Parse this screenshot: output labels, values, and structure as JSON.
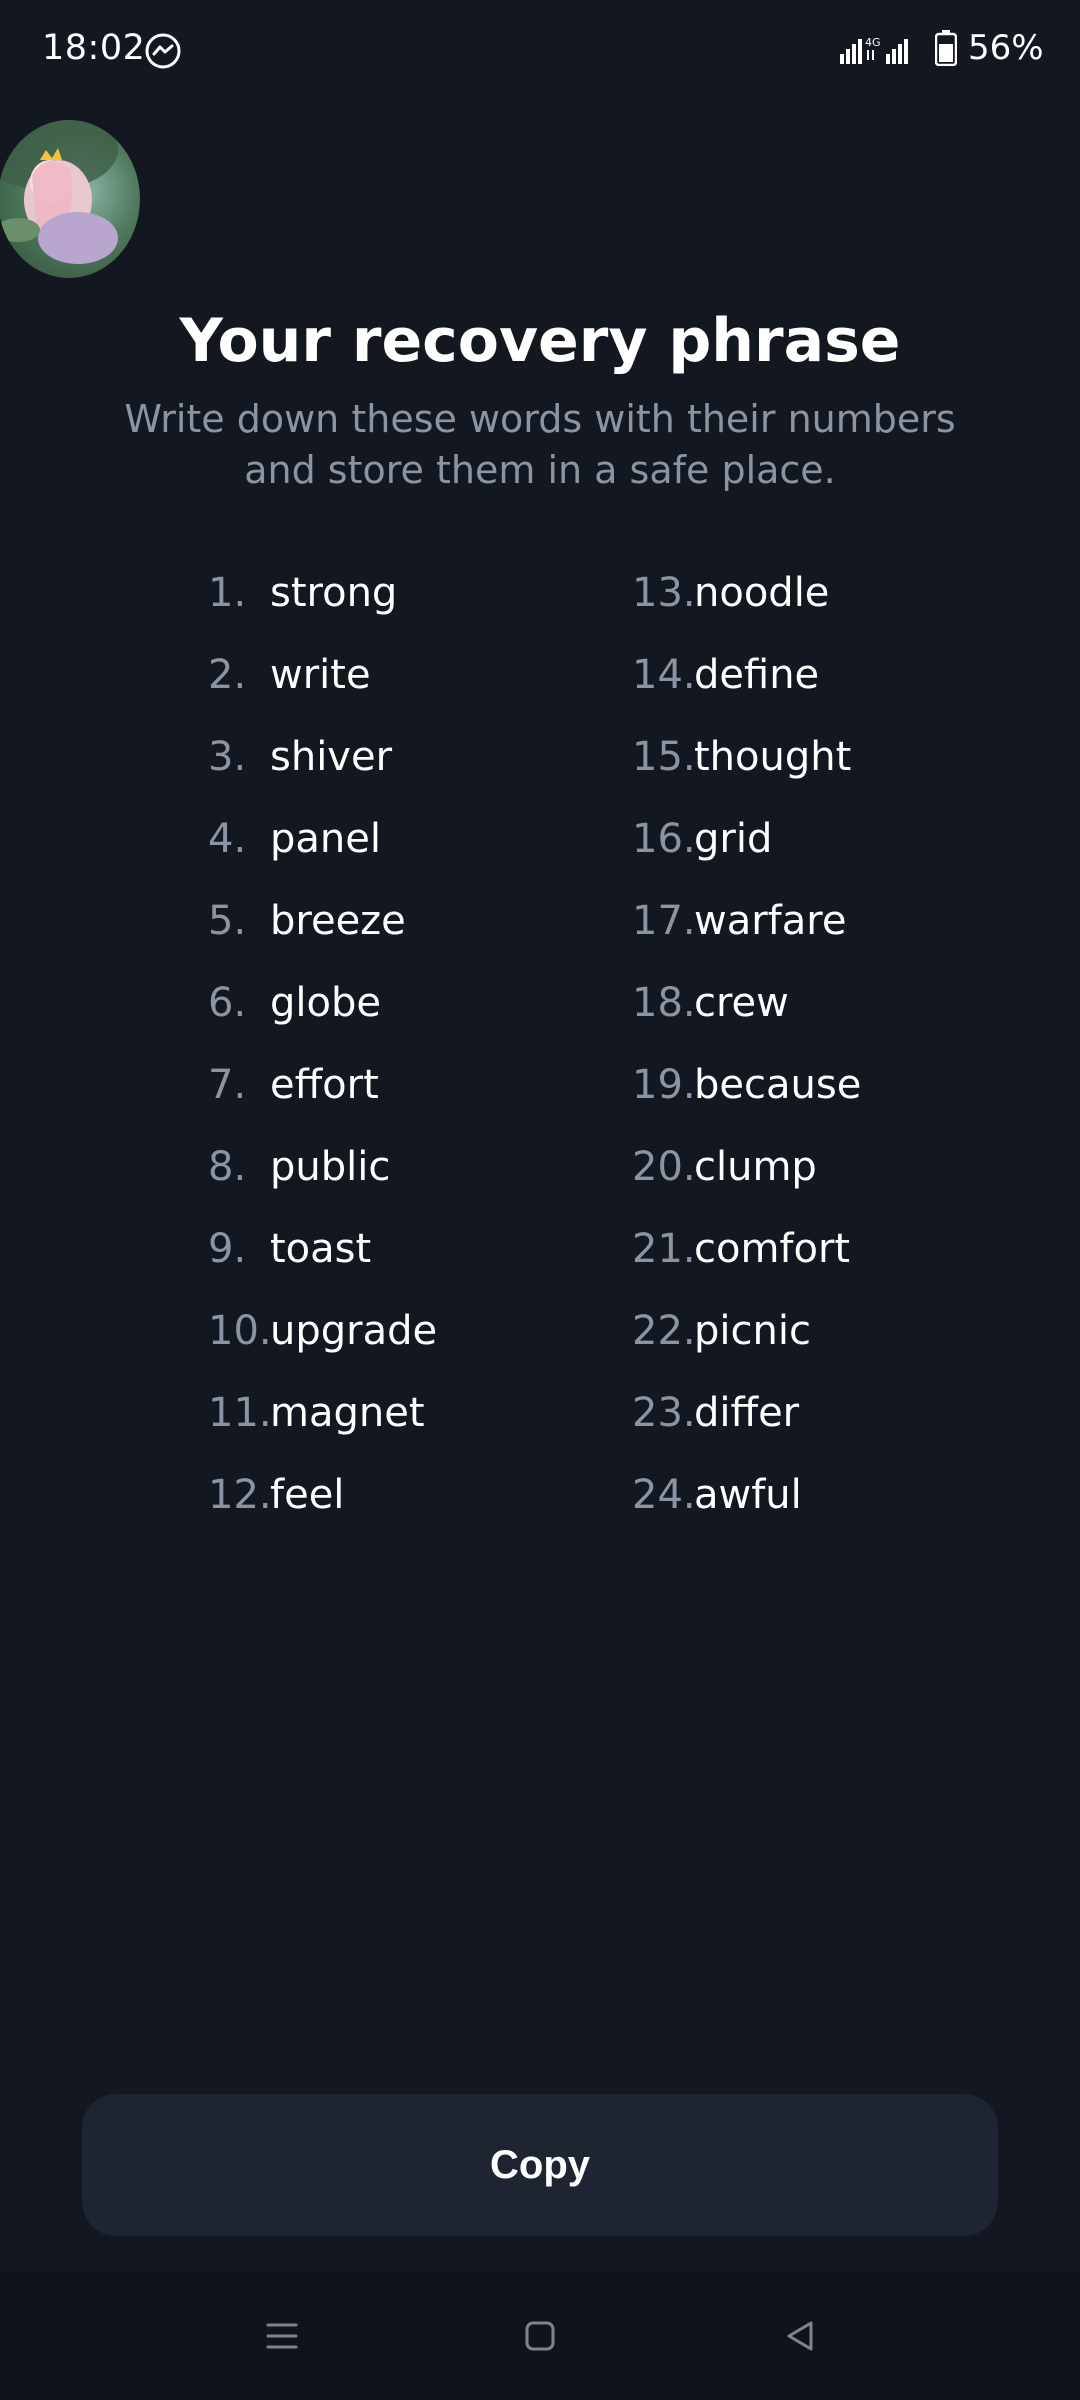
{
  "status_bar": {
    "time": "18:02",
    "battery": "56%",
    "icons": [
      "messenger-icon",
      "signal-4g-icon",
      "signal-icon",
      "battery-icon"
    ]
  },
  "header": {
    "title": "Your recovery phrase",
    "subtitle": "Write down these words with their numbers and store them in a safe place."
  },
  "phrase": {
    "left": [
      {
        "num": "1.",
        "word": "strong"
      },
      {
        "num": "2.",
        "word": "write"
      },
      {
        "num": "3.",
        "word": "shiver"
      },
      {
        "num": "4.",
        "word": "panel"
      },
      {
        "num": "5.",
        "word": "breeze"
      },
      {
        "num": "6.",
        "word": "globe"
      },
      {
        "num": "7.",
        "word": "effort"
      },
      {
        "num": "8.",
        "word": "public"
      },
      {
        "num": "9.",
        "word": "toast"
      },
      {
        "num": "10.",
        "word": "upgrade"
      },
      {
        "num": "11.",
        "word": "magnet"
      },
      {
        "num": "12.",
        "word": "feel"
      }
    ],
    "right": [
      {
        "num": "13.",
        "word": "noodle"
      },
      {
        "num": "14.",
        "word": "define"
      },
      {
        "num": "15.",
        "word": "thought"
      },
      {
        "num": "16.",
        "word": "grid"
      },
      {
        "num": "17.",
        "word": "warfare"
      },
      {
        "num": "18.",
        "word": "crew"
      },
      {
        "num": "19.",
        "word": "because"
      },
      {
        "num": "20.",
        "word": "clump"
      },
      {
        "num": "21.",
        "word": "comfort"
      },
      {
        "num": "22.",
        "word": "picnic"
      },
      {
        "num": "23.",
        "word": "differ"
      },
      {
        "num": "24.",
        "word": "awful"
      }
    ]
  },
  "actions": {
    "copy_label": "Copy"
  },
  "nav": {
    "icons": [
      "menu-icon",
      "home-icon",
      "back-icon"
    ]
  },
  "colors": {
    "background": "#131720",
    "muted_text": "#8b94a3",
    "button": "#1e2431"
  }
}
